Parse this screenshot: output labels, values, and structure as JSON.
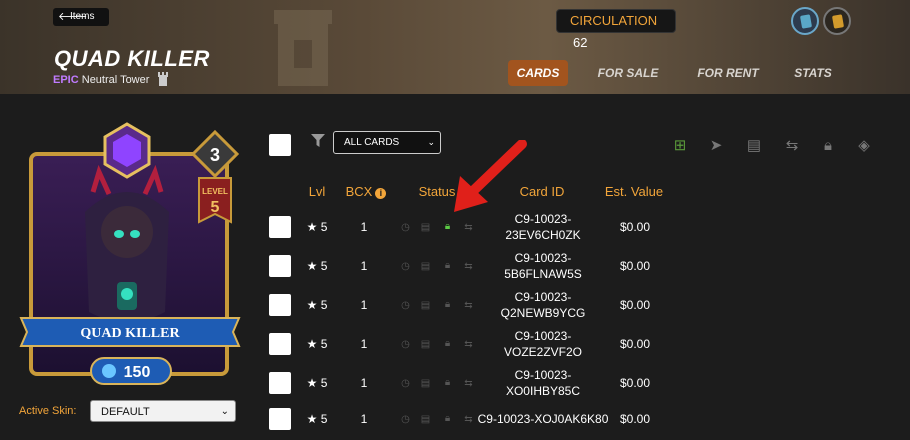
{
  "header": {
    "back_label": "Items",
    "title": "QUAD KILLER",
    "rarity": "EPIC",
    "subtitle_rest": "Neutral Tower",
    "circulation_label": "CIRCULATION",
    "circulation_value": "62",
    "tabs": [
      {
        "label": "CARDS",
        "active": true
      },
      {
        "label": "FOR SALE",
        "active": false
      },
      {
        "label": "FOR RENT",
        "active": false
      },
      {
        "label": "STATS",
        "active": false
      }
    ]
  },
  "card": {
    "name": "QUAD KILLER",
    "mana": "3",
    "level_label": "LEVEL",
    "level": "5",
    "power": "150"
  },
  "skin": {
    "label": "Active Skin:",
    "value": "DEFAULT"
  },
  "filter": {
    "value": "ALL CARDS"
  },
  "table": {
    "headers": {
      "lvl": "Lvl",
      "bcx": "BCX",
      "status": "Status",
      "card_id": "Card ID",
      "value": "Est. Value"
    },
    "rows": [
      {
        "lvl": "★ 5",
        "bcx": "1",
        "id1": "C9-10023-",
        "id2": "23EV6CH0ZK",
        "value": "$0.00",
        "locked": true
      },
      {
        "lvl": "★ 5",
        "bcx": "1",
        "id1": "C9-10023-",
        "id2": "5B6FLNAW5S",
        "value": "$0.00",
        "locked": false
      },
      {
        "lvl": "★ 5",
        "bcx": "1",
        "id1": "C9-10023-",
        "id2": "Q2NEWB9YCG",
        "value": "$0.00",
        "locked": false
      },
      {
        "lvl": "★ 5",
        "bcx": "1",
        "id1": "C9-10023-",
        "id2": "VOZE2ZVF2O",
        "value": "$0.00",
        "locked": false
      },
      {
        "lvl": "★ 5",
        "bcx": "1",
        "id1": "C9-10023-",
        "id2": "XO0IHBY85C",
        "value": "$0.00",
        "locked": false
      },
      {
        "lvl": "★ 5",
        "bcx": "1",
        "id1": "C9-10023-XOJ0AK6K80",
        "id2": "",
        "value": "$0.00",
        "locked": false
      }
    ]
  },
  "colors": {
    "accent_orange": "#f2a53a",
    "active_tab": "#a2541e",
    "epic_purple": "#c07bff",
    "lock_green": "#5ccb45",
    "annotation_red": "#e0201a"
  }
}
